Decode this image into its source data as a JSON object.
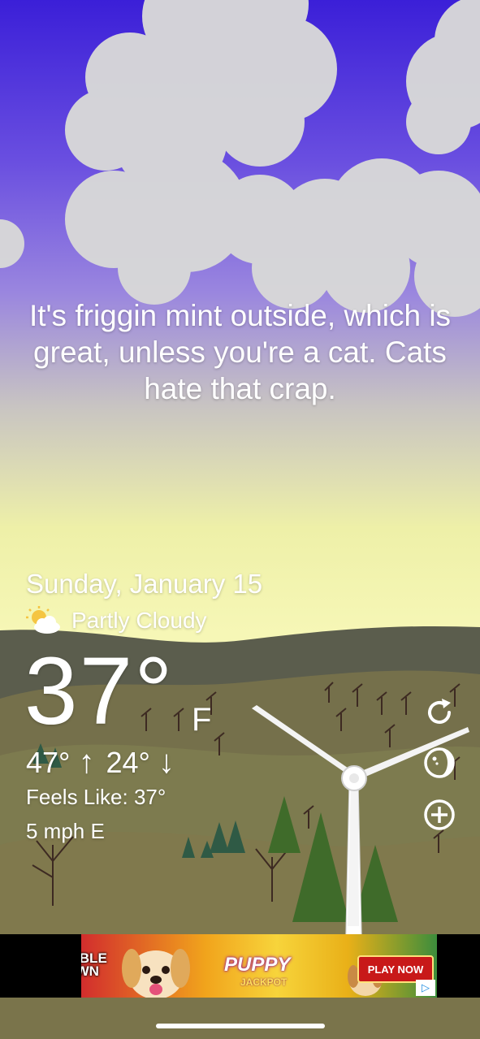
{
  "message": "It's friggin mint outside, which is great, unless you're a cat. Cats hate that crap.",
  "weather": {
    "date": "Sunday, January 15",
    "condition": "Partly Cloudy",
    "condition_icon": "partly-cloudy-icon",
    "temperature": "37°",
    "unit": "F",
    "high": "47°",
    "low": "24°",
    "feels_like": "Feels Like: 37°",
    "wind": "5 mph E"
  },
  "side_actions": [
    {
      "name": "refresh-icon"
    },
    {
      "name": "moon-phase-icon"
    },
    {
      "name": "add-location-icon"
    }
  ],
  "ad": {
    "brand_logo": "DOUBLE DOWN",
    "game_title": "PUPPY",
    "game_subtitle": "JACKPOT",
    "cta": "PLAY NOW",
    "choices_icon": "▷"
  },
  "colors": {
    "sky_top": "#3b1fd8",
    "sky_bottom": "#f6f7b6",
    "hill_dark": "#5b5d4d",
    "ground": "#7f7a4d",
    "text": "#ffffff"
  }
}
